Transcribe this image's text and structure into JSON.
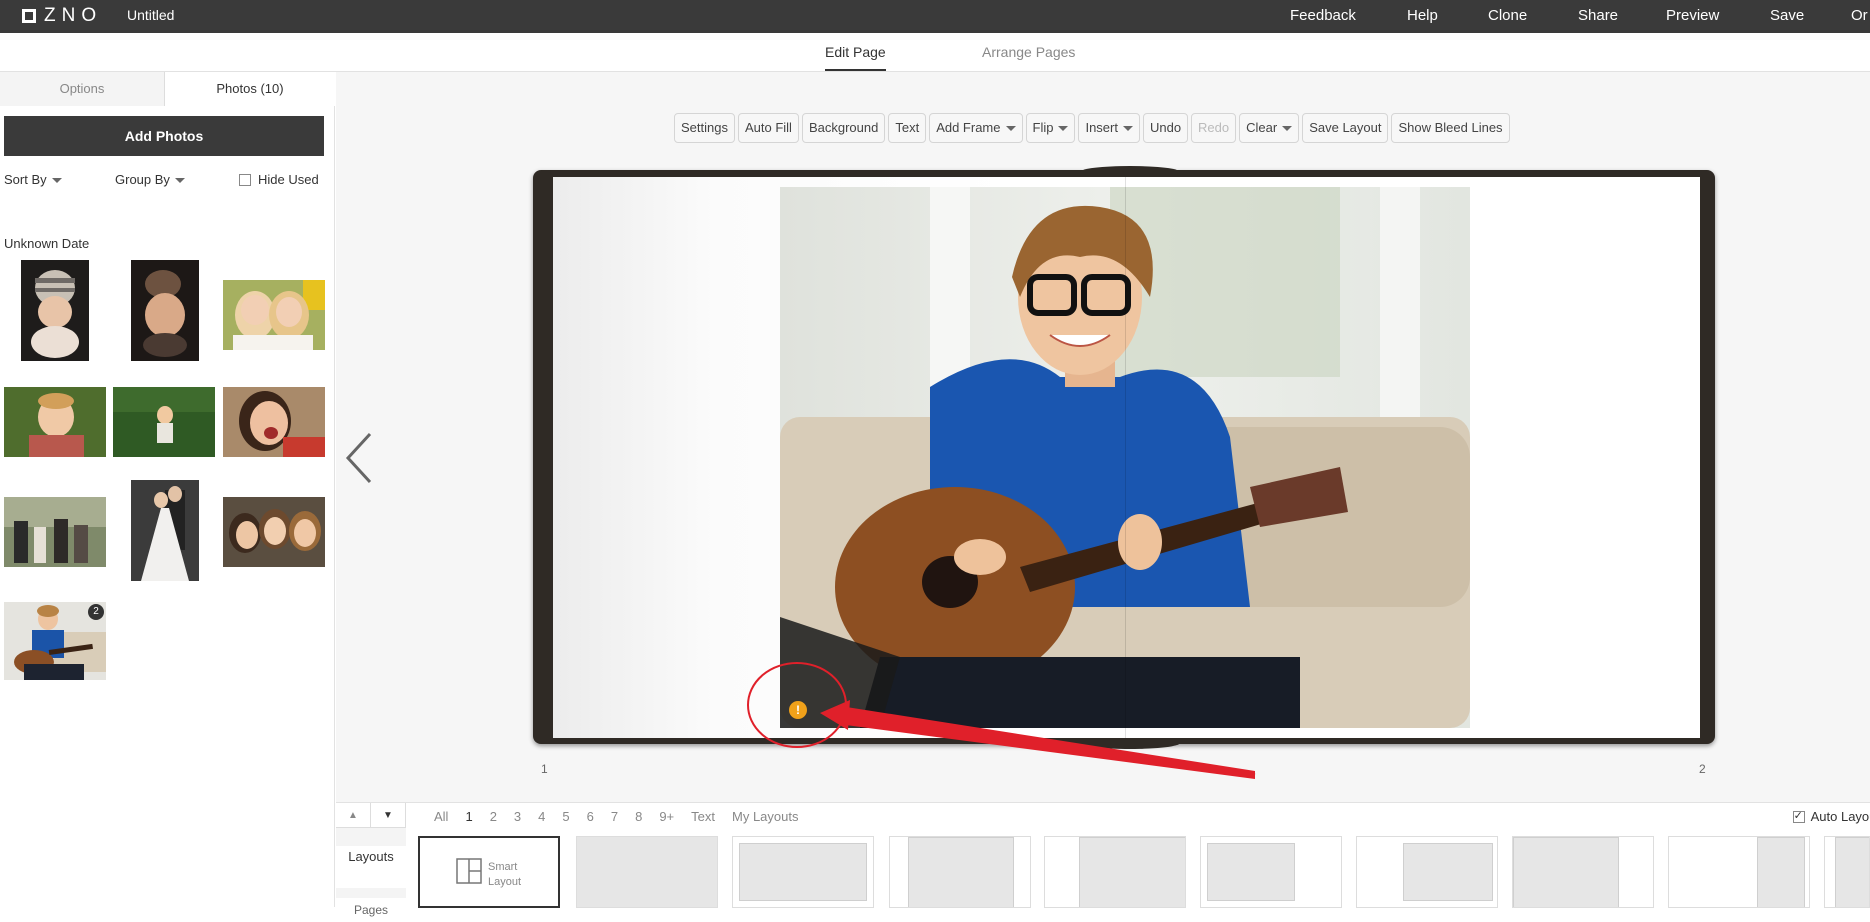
{
  "app": {
    "logo": "ZNO",
    "document_title": "Untitled"
  },
  "topnav": {
    "feedback": "Feedback",
    "help": "Help",
    "clone": "Clone",
    "share": "Share",
    "preview": "Preview",
    "save": "Save",
    "order": "Or"
  },
  "edit_tabs": {
    "edit_page": "Edit Page",
    "arrange_pages": "Arrange Pages"
  },
  "left_panel": {
    "tabs": {
      "options": "Options",
      "photos": "Photos (10)"
    },
    "add_photos": "Add Photos",
    "sort_by": "Sort By",
    "group_by": "Group By",
    "hide_used": "Hide Used",
    "date_group": "Unknown Date",
    "used_badge": "2"
  },
  "toolbar": {
    "settings": "Settings",
    "auto_fill": "Auto Fill",
    "background": "Background",
    "text": "Text",
    "add_frame": "Add Frame",
    "flip": "Flip",
    "insert": "Insert",
    "undo": "Undo",
    "redo": "Redo",
    "clear": "Clear",
    "save_layout": "Save Layout",
    "show_bleed_lines": "Show Bleed Lines"
  },
  "canvas": {
    "left_page_number": "1",
    "right_page_number": "2",
    "warning_symbol": "!"
  },
  "bottom": {
    "filters": [
      "All",
      "1",
      "2",
      "3",
      "4",
      "5",
      "6",
      "7",
      "8",
      "9+",
      "Text",
      "My Layouts"
    ],
    "active_filter": "1",
    "auto_layout": "Auto Layout",
    "side_tabs": {
      "layouts": "Layouts",
      "pages": "Pages"
    },
    "smart_layout_line1": "Smart",
    "smart_layout_line2": "Layout"
  },
  "colors": {
    "topbar": "#3a3a3a",
    "warning": "#f0a11a",
    "annotation": "#e0202a"
  }
}
